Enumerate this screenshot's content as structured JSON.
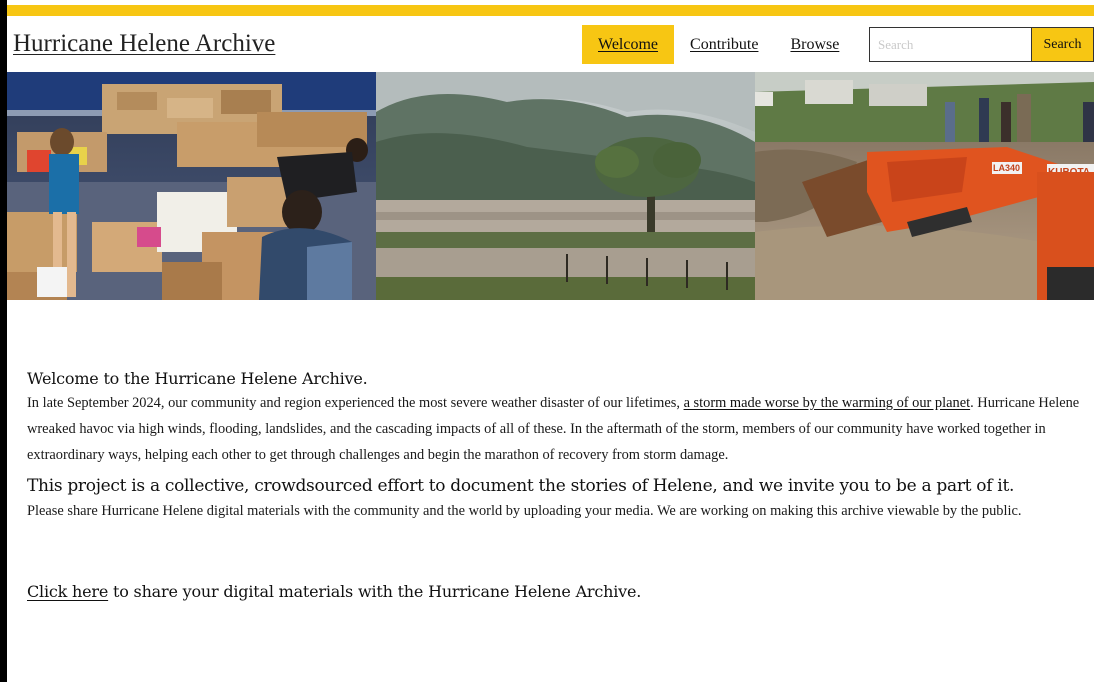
{
  "header": {
    "site_title": "Hurricane Helene Archive",
    "nav": [
      {
        "label": "Welcome",
        "active": true
      },
      {
        "label": "Contribute",
        "active": false
      },
      {
        "label": "Browse",
        "active": false
      }
    ],
    "search": {
      "placeholder": "Search",
      "button_label": "Search"
    }
  },
  "banner": {
    "photos": [
      "volunteers-sorting-donations-photo",
      "flooded-field-photo",
      "kubota-excavator-cleanup-photo"
    ],
    "excavator_brand": "KUBOTA",
    "excavator_model": "LA340"
  },
  "content": {
    "welcome_heading": "Welcome to the Hurricane Helene Archive.",
    "intro_before_link": "In late September 2024, our community and region experienced the most severe weather disaster of our lifetimes, ",
    "intro_link": "a storm made worse by the warming of our planet",
    "intro_after_link": ". Hurricane Helene wreaked havoc via high winds, flooding, landslides, and the cascading impacts of all of these. In the aftermath of the storm, members of our community have worked together in extraordinary ways, helping each other to get through challenges and begin the marathon of recovery from storm damage.",
    "project_heading": "This project is a collective, crowdsourced effort to document the stories of Helene, and we invite you to be a part of it.",
    "share_paragraph": "Please share Hurricane Helene digital materials with the community and the world by uploading your media. We are working on making this archive viewable by the public.",
    "cta_link": "Click here",
    "cta_text": " to share your digital materials with the Hurricane Helene Archive."
  },
  "colors": {
    "accent": "#f7c613",
    "text": "#111111",
    "background": "#ffffff",
    "frame": "#000000"
  }
}
